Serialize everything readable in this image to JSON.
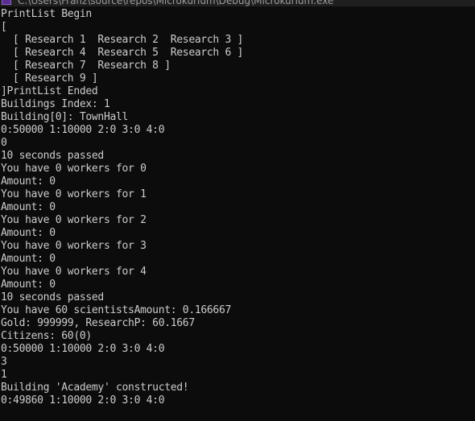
{
  "window": {
    "title": "C:\\Users\\Franz\\source\\repos\\Microkurium\\Debug\\Microkurium.exe"
  },
  "console": {
    "lines": [
      "PrintList Begin",
      "[",
      "  [ Research 1  Research 2  Research 3 ]",
      "  [ Research 4  Research 5  Research 6 ]",
      "  [ Research 7  Research 8 ]",
      "  [ Research 9 ]",
      "]PrintList Ended",
      "Buildings Index: 1",
      "Building[0]: TownHall",
      "0:50000 1:10000 2:0 3:0 4:0",
      "0",
      "10 seconds passed",
      "You have 0 workers for 0",
      "Amount: 0",
      "You have 0 workers for 1",
      "Amount: 0",
      "You have 0 workers for 2",
      "Amount: 0",
      "You have 0 workers for 3",
      "Amount: 0",
      "You have 0 workers for 4",
      "Amount: 0",
      "10 seconds passed",
      "You have 60 scientistsAmount: 0.166667",
      "Gold: 999999, ResearchP: 60.1667",
      "Citizens: 60(0)",
      "0:50000 1:10000 2:0 3:0 4:0",
      "3",
      "1",
      "Building 'Academy' constructed!",
      "0:49860 1:10000 2:0 3:0 4:0"
    ]
  }
}
